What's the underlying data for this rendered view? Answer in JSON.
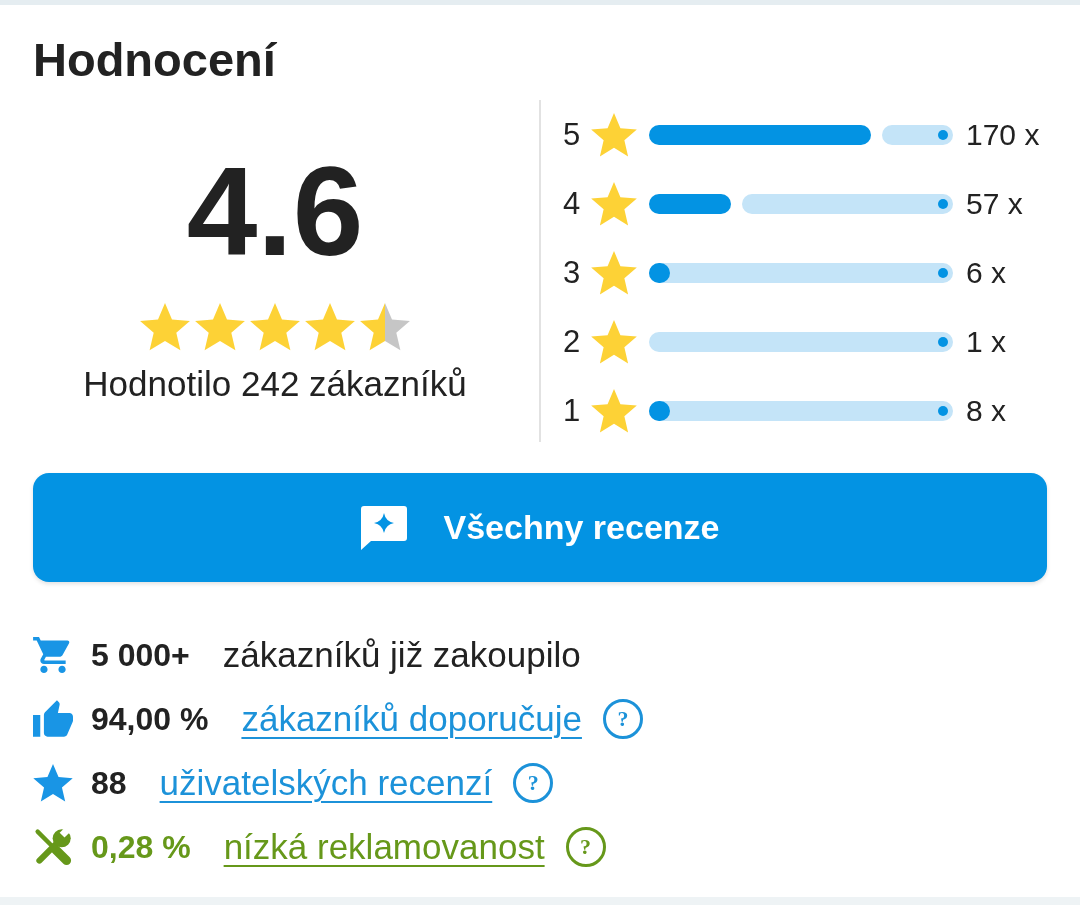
{
  "title": "Hodnocení",
  "rating": {
    "score": "4.6",
    "stars": 4.5,
    "caption": "Hodnotilo 242 zákazníků"
  },
  "breakdown": [
    {
      "label": "5",
      "level": 0.73,
      "count": "170 x"
    },
    {
      "label": "4",
      "level": 0.27,
      "count": "57 x"
    },
    {
      "label": "3",
      "level": 0.07,
      "count": "6 x"
    },
    {
      "label": "2",
      "level": 0,
      "count": "1 x"
    },
    {
      "label": "1",
      "level": 0.07,
      "count": "8 x"
    }
  ],
  "all_reviews_button": {
    "label": "Všechny recenze"
  },
  "stats": [
    {
      "kind": "purchases",
      "value": "5 000+",
      "text": "zákazníků již zakoupilo",
      "link": false,
      "positive": false
    },
    {
      "kind": "recommendations",
      "value": "94,00 %",
      "text": "zákazníků doporučuje",
      "link": true,
      "help": "?",
      "positive": false
    },
    {
      "kind": "reviews",
      "value": "88",
      "text": "uživatelských recenzí",
      "link": true,
      "help": "?",
      "positive": false
    },
    {
      "kind": "complaints",
      "value": "0,28 %",
      "text": "nízká reklamovanost",
      "link": true,
      "help": "?",
      "positive": true
    }
  ]
}
